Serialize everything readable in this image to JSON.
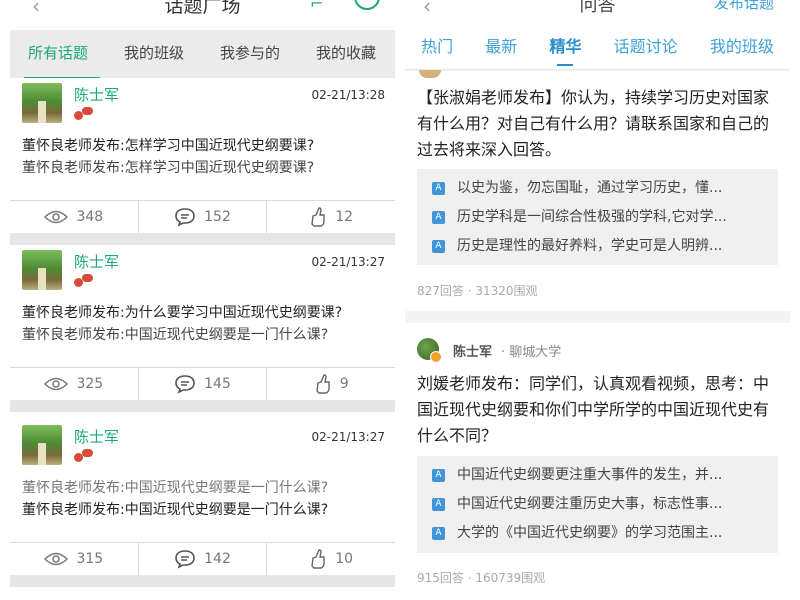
{
  "left": {
    "header": {
      "title": "话题广场"
    },
    "tabs": [
      {
        "label": "所有话题",
        "active": true
      },
      {
        "label": "我的班级",
        "active": false
      },
      {
        "label": "我参与的",
        "active": false
      },
      {
        "label": "我的收藏",
        "active": false
      }
    ],
    "posts": [
      {
        "author": "陈士军",
        "time": "02-21/13:28",
        "line1": "董怀良老师发布:怎样学习中国近现代史纲要课?",
        "line2": "董怀良老师发布:怎样学习中国近现代史纲要课?",
        "views": "348",
        "comments": "152",
        "likes": "12"
      },
      {
        "author": "陈士军",
        "time": "02-21/13:27",
        "line1": "董怀良老师发布:为什么要学习中国近现代史纲要课?",
        "line2": "董怀良老师发布:中国近现代史纲要是一门什么课?",
        "views": "325",
        "comments": "145",
        "likes": "9"
      },
      {
        "author": "陈士军",
        "time": "02-21/13:27",
        "line1": "董怀良老师发布:中国近现代史纲要是一门什么课?",
        "line2": "董怀良老师发布:中国近现代史纲要是一门什么课?",
        "views": "315",
        "comments": "142",
        "likes": "10"
      }
    ]
  },
  "right": {
    "header": {
      "title": "问答",
      "action": "发布话题"
    },
    "tabs": [
      {
        "label": "热门",
        "active": false
      },
      {
        "label": "最新",
        "active": false
      },
      {
        "label": "精华",
        "active": true
      },
      {
        "label": "话题讨论",
        "active": false
      },
      {
        "label": "我的班级",
        "active": false
      }
    ],
    "cards": [
      {
        "question": "【张淑娟老师发布】你认为，持续学习历史对国家有什么用？对自己有什么用？请联系国家和自己的过去将来深入回答。",
        "answers": [
          "以史为鉴，勿忘国耻，通过学习历史，懂...",
          "历史学科是一间综合性极强的学科,它对学...",
          "历史是理性的最好养料，学史可是人明辨..."
        ],
        "meta": "827回答 · 31320围观"
      },
      {
        "author": "陈士军",
        "school": "· 聊城大学",
        "question": "刘媛老师发布：同学们，认真观看视频，思考：中国近现代史纲要和你们中学所学的中国近现代史有什么不同？",
        "answers": [
          "中国近代史纲要更注重大事件的发生，并...",
          "中国近代史纲要注重历史大事，标志性事...",
          "大学的《中国近代史纲要》的学习范围主..."
        ],
        "meta": "915回答 · 160739围观"
      }
    ]
  },
  "icons": {
    "views": "eye-icon",
    "comments": "comment-bubble-icon",
    "likes": "thumbs-up-icon",
    "answer": "answer-a-icon"
  },
  "colors": {
    "green": "#19a97b",
    "blue": "#3ea0d6",
    "red": "#d84a3a"
  }
}
